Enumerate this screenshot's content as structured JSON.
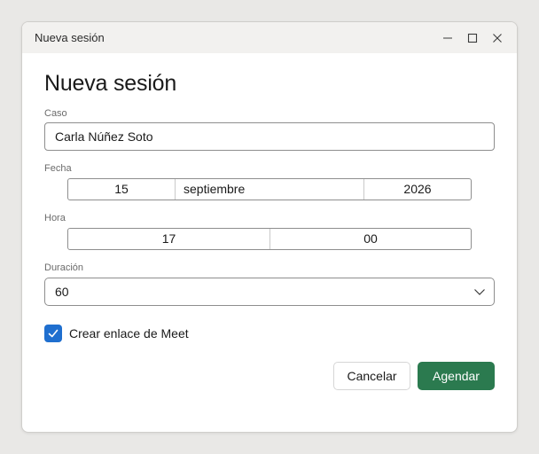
{
  "window": {
    "title": "Nueva sesión"
  },
  "form": {
    "heading": "Nueva sesión",
    "caso": {
      "label": "Caso",
      "value": "Carla Núñez Soto"
    },
    "fecha": {
      "label": "Fecha",
      "day": "15",
      "month": "septiembre",
      "year": "2026"
    },
    "hora": {
      "label": "Hora",
      "hour": "17",
      "minute": "00"
    },
    "duracion": {
      "label": "Duración",
      "value": "60"
    },
    "meet": {
      "label": "Crear enlace de Meet",
      "checked": true
    },
    "cancel_label": "Cancelar",
    "submit_label": "Agendar"
  },
  "colors": {
    "primary": "#2b7a4f",
    "checkbox": "#1f6fcf"
  },
  "icons": {
    "minimize": "minimize-icon",
    "maximize": "maximize-icon",
    "close": "close-icon",
    "chevron": "chevron-down-icon",
    "check": "checkmark-icon"
  }
}
